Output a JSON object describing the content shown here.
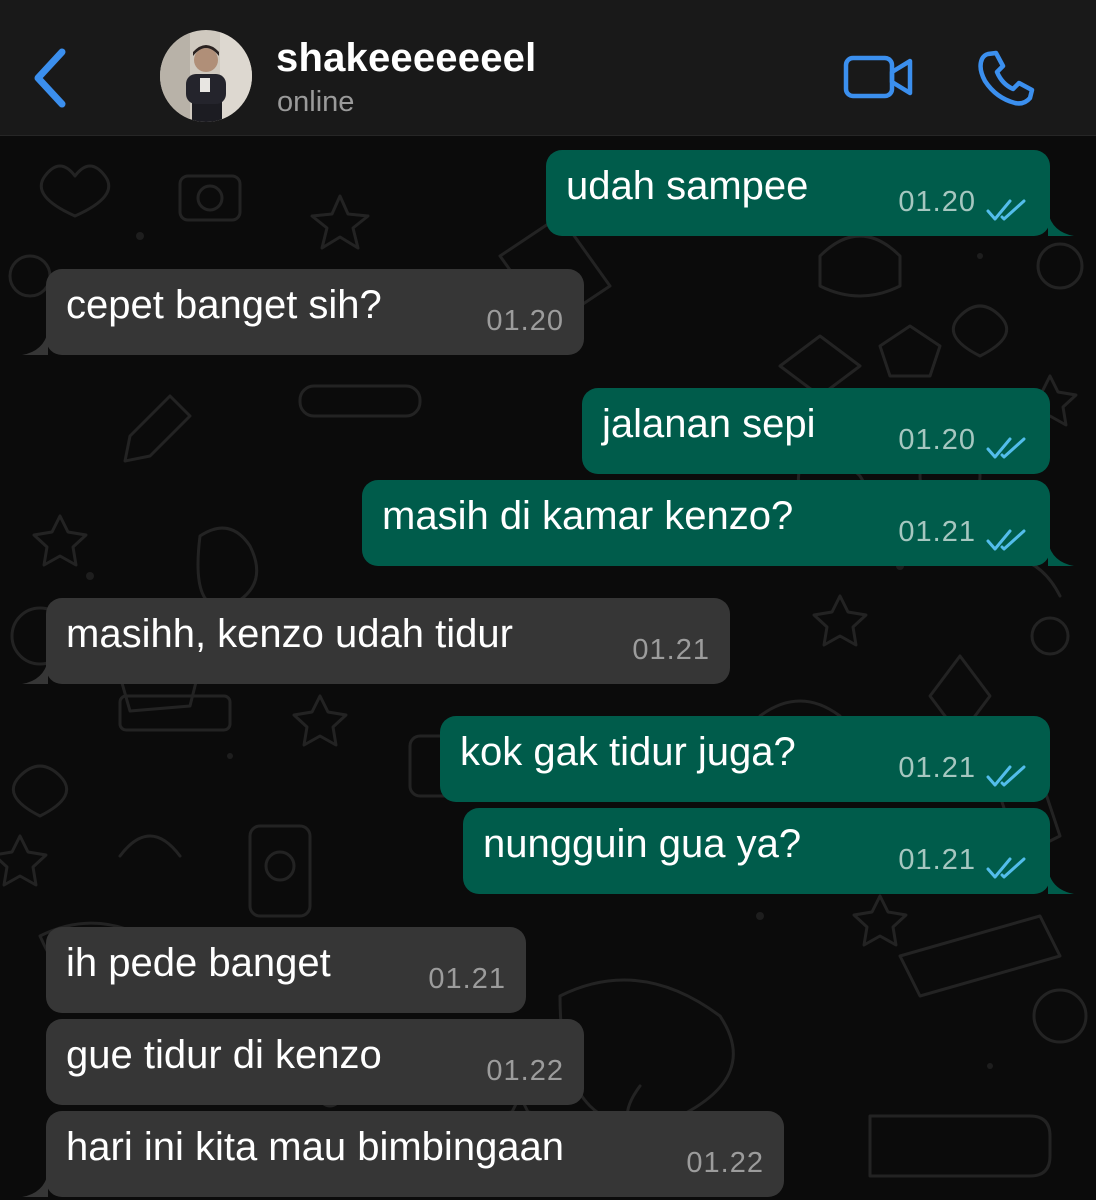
{
  "header": {
    "contact_name": "shakeeeeeeel",
    "status": "online",
    "icons": {
      "back": "chevron-left-icon",
      "video": "video-call-icon",
      "call": "phone-icon"
    },
    "accent_color": "#3b8fee"
  },
  "chat": {
    "outgoing_bubble_color": "#005c4b",
    "incoming_bubble_color": "#363636",
    "read_tick_color": "#53bdeb",
    "messages": [
      {
        "direction": "out",
        "text": "udah sampee",
        "time": "01.20",
        "status": "read"
      },
      {
        "direction": "in",
        "text": "cepet banget sih?",
        "time": "01.20"
      },
      {
        "direction": "out",
        "text": "jalanan sepi",
        "time": "01.20",
        "status": "read"
      },
      {
        "direction": "out",
        "text": "masih di kamar kenzo?",
        "time": "01.21",
        "status": "read"
      },
      {
        "direction": "in",
        "text": "masihh, kenzo udah tidur",
        "time": "01.21"
      },
      {
        "direction": "out",
        "text": "kok gak tidur juga?",
        "time": "01.21",
        "status": "read"
      },
      {
        "direction": "out",
        "text": "nungguin gua ya?",
        "time": "01.21",
        "status": "read"
      },
      {
        "direction": "in",
        "text": "ih pede banget",
        "time": "01.21"
      },
      {
        "direction": "in",
        "text": "gue tidur di kenzo",
        "time": "01.22"
      },
      {
        "direction": "in",
        "text": "hari ini kita mau bimbingaan",
        "time": "01.22"
      }
    ]
  }
}
